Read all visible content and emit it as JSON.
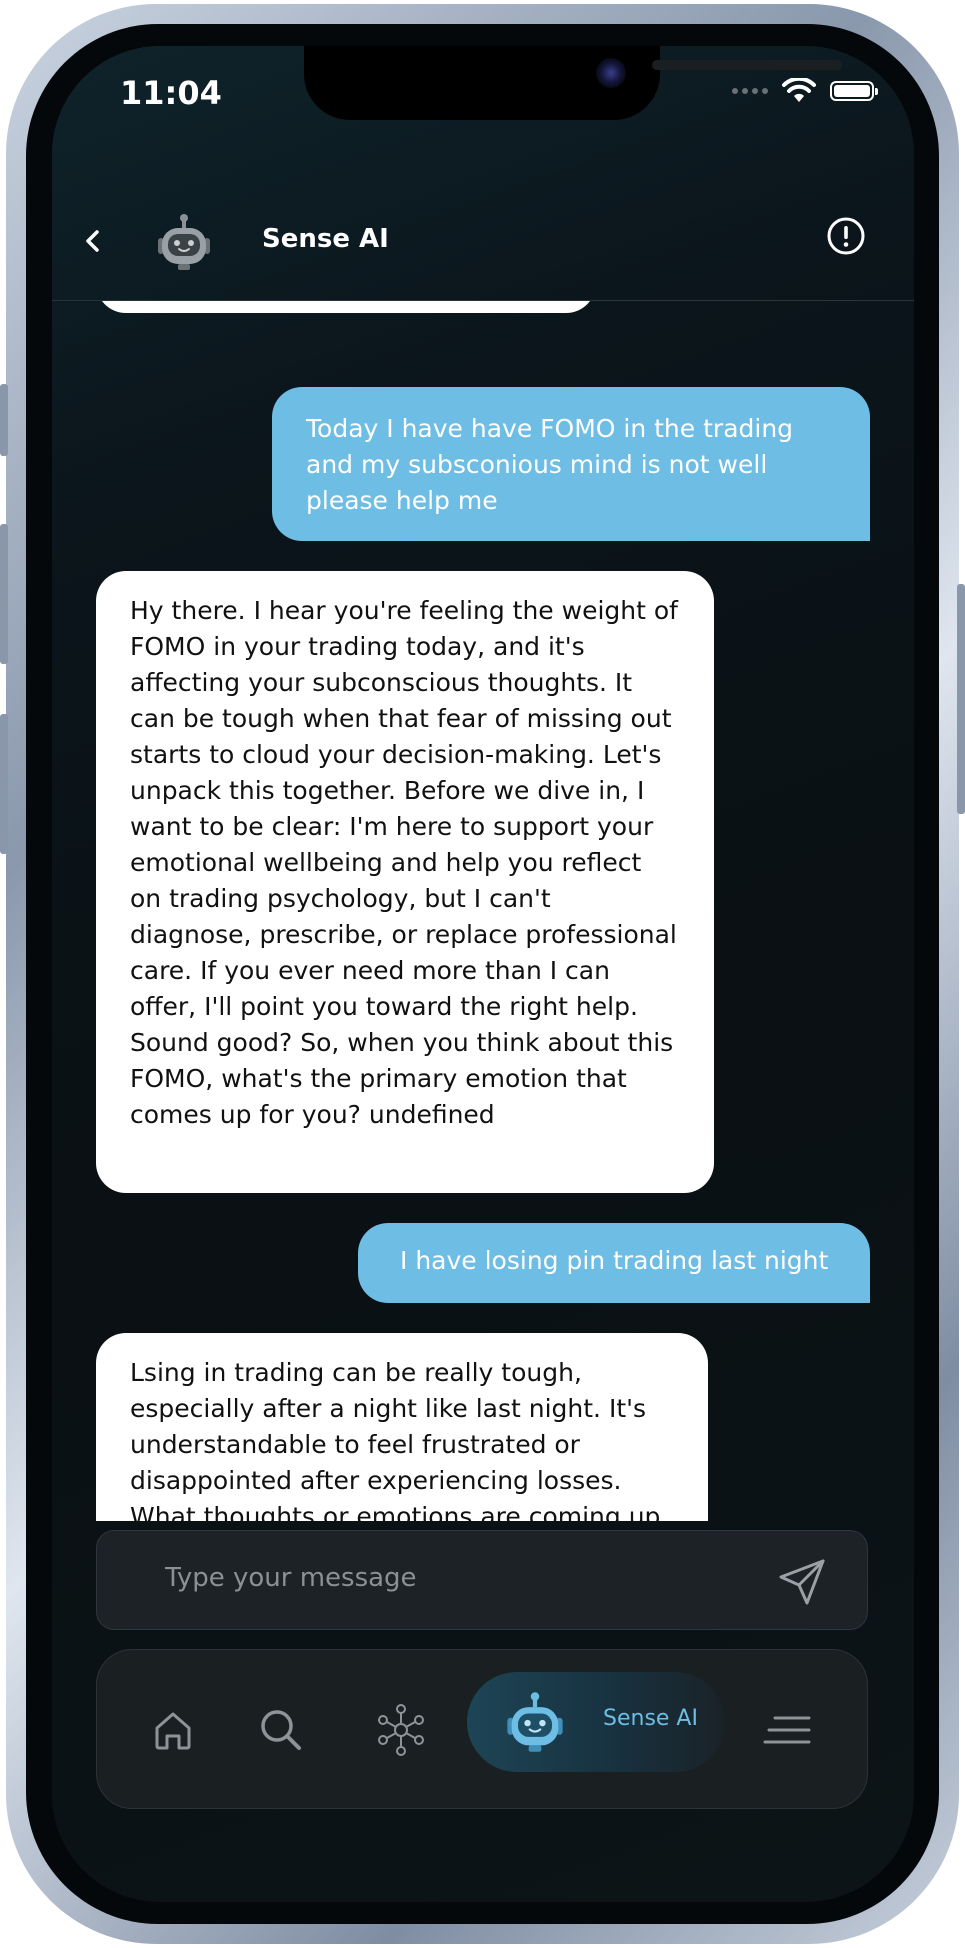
{
  "status_bar": {
    "time": "11:04"
  },
  "header": {
    "title": "Sense AI"
  },
  "messages": [
    {
      "role": "user",
      "text": "Today I have  have FOMO in the trading and my subsconious mind is not well please help me"
    },
    {
      "role": "bot",
      "text": "Hy there. I hear you're feeling the weight of FOMO in your trading today, and it's affecting your subconscious thoughts. It can be tough when that fear of missing out starts to cloud your decision-making. Let's unpack this together. Before we dive in, I want to be clear: I'm here to support your emotional wellbeing and help you reflect on trading psychology, but I can't diagnose, prescribe, or replace professional care. If you ever need more than I can offer, I'll point you toward the right help. Sound good? So, when you think about this FOMO, what's the primary emotion that comes up for you? undefined"
    },
    {
      "role": "user",
      "text": "I have losing pin trading last night"
    },
    {
      "role": "bot",
      "text": "Lsing in trading can be really tough, especially after a night like last night. It's understandable to feel frustrated or disappointed after experiencing losses. What thoughts or emotions are coming up for you right now as you reflect on this"
    }
  ],
  "input": {
    "placeholder": "Type your message"
  },
  "bottom_nav": {
    "items": [
      "home-icon",
      "search-icon",
      "network-icon",
      "robot-icon",
      "menu-icon"
    ],
    "active_label": "Sense AI"
  },
  "colors": {
    "user_bubble": "#6dbde5",
    "bot_bubble": "#ffffff",
    "accent": "#6dbde5"
  }
}
